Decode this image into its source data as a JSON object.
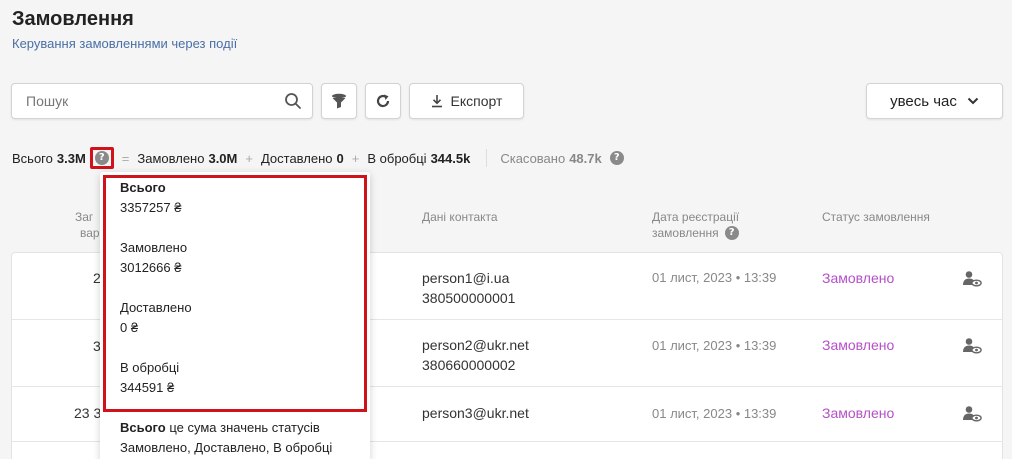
{
  "header": {
    "title": "Замовлення",
    "subtitle": "Керування замовленнями через події"
  },
  "toolbar": {
    "search_placeholder": "Пошук",
    "search_icon": "search-icon",
    "filter_icon": "funnel-icon",
    "refresh_icon": "refresh-icon",
    "export_label": "Експорт",
    "export_icon": "download-icon",
    "period_label": "увесь час",
    "period_icon": "chevron-down-icon"
  },
  "stats": {
    "total_label": "Всього",
    "total_value": "3.3M",
    "eq": "=",
    "plus": "+",
    "ordered_label": "Замовлено",
    "ordered_value": "3.0M",
    "delivered_label": "Доставлено",
    "delivered_value": "0",
    "processing_label": "В обробці",
    "processing_value": "344.5k",
    "cancelled_label": "Скасовано",
    "cancelled_value": "48.7k",
    "help_glyph": "?"
  },
  "columns": {
    "total_partial_1": "Заг",
    "total_partial_2": "вар",
    "contact": "Дані контакта",
    "date_line1": "Дата реєстрації",
    "date_line2": "замовлення",
    "status": "Статус замовлення"
  },
  "rows": [
    {
      "num": "2",
      "email": "person1@i.ua",
      "phone": "380500000001",
      "date": "01 лист, 2023 • 13:39",
      "status": "Замовлено"
    },
    {
      "num": "3",
      "email": "person2@ukr.net",
      "phone": "380660000002",
      "date": "01 лист, 2023 • 13:39",
      "status": "Замовлено"
    },
    {
      "num": "23 3",
      "email": "person3@ukr.net",
      "phone": "",
      "date": "01 лист, 2023 • 13:39",
      "status": "Замовлено"
    }
  ],
  "tooltip": {
    "total_label": "Всього",
    "total_value": "3357257 ₴",
    "ordered_label": "Замовлено",
    "ordered_value": "3012666 ₴",
    "delivered_label": "Доставлено",
    "delivered_value": "0 ₴",
    "processing_label": "В обробці",
    "processing_value": "344591 ₴",
    "foot_bold": "Всього",
    "foot_text": " це сума значень статусів",
    "foot_line2": "Замовлено, Доставлено, В обробці"
  },
  "colors": {
    "accent_link": "#4a6fa5",
    "status_purple": "#b54fc9",
    "highlight_red": "#d0121b"
  }
}
